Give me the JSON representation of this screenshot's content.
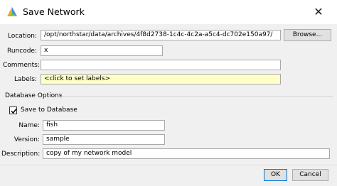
{
  "window": {
    "title": "Save Network"
  },
  "icons": {
    "app": "network-app-icon",
    "close": "close-icon",
    "check": "checkmark-icon"
  },
  "form": {
    "location": {
      "label": "Location:",
      "value": "/opt/northstar/data/archives/4f8d2738-1c4c-4c2a-a5c4-dc702e150a97/"
    },
    "browse_label": "Browse...",
    "runcode": {
      "label": "Runcode:",
      "value": "x"
    },
    "comments": {
      "label": "Comments:",
      "value": ""
    },
    "labels": {
      "label": "Labels:",
      "value": "<click to set labels>"
    }
  },
  "database": {
    "group_title": "Database Options",
    "save_label": "Save to Database",
    "save_checked": true,
    "name": {
      "label": "Name:",
      "value": "fish"
    },
    "version": {
      "label": "Version:",
      "value": "sample"
    },
    "description": {
      "label": "Description:",
      "value": "copy of my network model"
    }
  },
  "footer": {
    "ok_label": "OK",
    "cancel_label": "Cancel"
  }
}
